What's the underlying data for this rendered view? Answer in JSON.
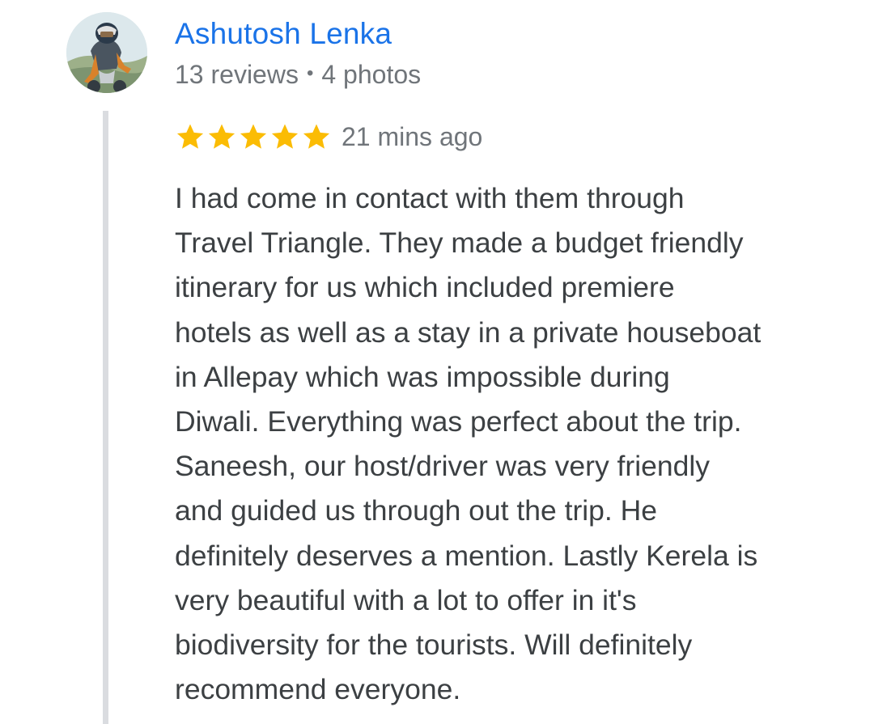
{
  "review": {
    "author": {
      "name": "Ashutosh Lenka",
      "reviews_count": "13 reviews",
      "separator": "•",
      "photos_count": "4 photos"
    },
    "rating": {
      "stars": 5,
      "max_stars": 5,
      "star_icon": "star-icon",
      "star_color": "#fbbc04"
    },
    "time_ago": "21 mins ago",
    "text": "I had come in contact with them through\nTravel Triangle. They made a budget friendly\nitinerary for us which included premiere\nhotels as well as a stay in a private houseboat\nin Allepay which was impossible during\nDiwali. Everything was perfect about the trip.\nSaneesh, our host/driver was very friendly\nand guided us through out the trip. He\ndefinitely deserves a mention. Lastly Kerela is\nvery beautiful with a lot to offer in it's\nbiodiversity for the tourists. Will definitely\nrecommend everyone."
  },
  "colors": {
    "author_link": "#1a73e8",
    "secondary_text": "#70757a",
    "body_text": "#3c4043",
    "thread_line": "#dadce0"
  }
}
